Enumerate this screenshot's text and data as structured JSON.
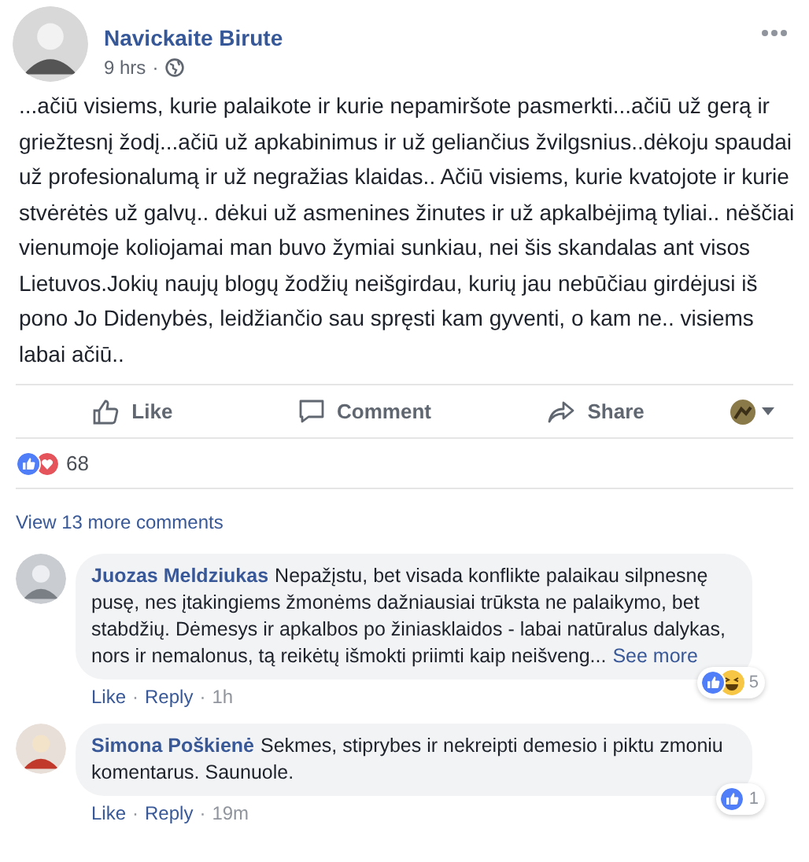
{
  "post": {
    "author": "Navickaite Birute",
    "time": "9 hrs",
    "separator": "·",
    "text": "...ačiū visiems, kurie palaikote ir kurie nepamiršote pasmerkti...ačiū už gerą ir griežtesnį žodį...ačiū už apkabinimus ir už geliančius žvilgsnius..dėkoju spaudai už profesionalumą ir už negražias klaidas.. Ačiū visiems, kurie kvatojote ir kurie stvėrėtės už galvų.. dėkui už asmenines žinutes ir už apkalbėjimą tyliai.. nėščiai vienumoje koliojamai man buvo žymiai sunkiau, nei šis skandalas ant visos Lietuvos.Jokių naujų blogų žodžių neišgirdau, kurių jau nebūčiau girdėjusi iš pono Jo Didenybės, leidžiančio sau spręsti kam gyventi, o kam ne.. visiems labai ačiū.."
  },
  "actions": [
    {
      "kind": "like",
      "label": "Like"
    },
    {
      "kind": "comment",
      "label": "Comment"
    },
    {
      "kind": "share",
      "label": "Share"
    }
  ],
  "reactions": {
    "kinds": [
      {
        "kind": "like"
      },
      {
        "kind": "love"
      }
    ],
    "count": "68"
  },
  "view_more": "View 13 more comments",
  "comments": [
    {
      "author": "Juozas Meldziukas",
      "text": "Nepažįstu, bet visada konflikte palaikau silpnesnę pusę, nes įtakingiems žmonėms dažniausiai trūksta ne palaikymo, bet stabdžių. Dėmesys ir apkalbos po žiniasklaidos - labai natūralus dalykas, nors ir nemalonus, tą reikėtų išmokti priimti kaip neišveng...",
      "see_more": "See more",
      "reactions": {
        "kinds": [
          {
            "kind": "like"
          },
          {
            "kind": "haha"
          }
        ],
        "count": "5"
      },
      "like": "Like",
      "reply": "Reply",
      "time": "1h"
    },
    {
      "author": "Simona Poškienė",
      "text": "Sekmes, stiprybes ir nekreipti demesio i piktu zmoniu komentarus. Saunuole.",
      "reactions": {
        "kinds": [
          {
            "kind": "like"
          }
        ],
        "count": "1"
      },
      "like": "Like",
      "reply": "Reply",
      "time": "19m"
    }
  ]
}
